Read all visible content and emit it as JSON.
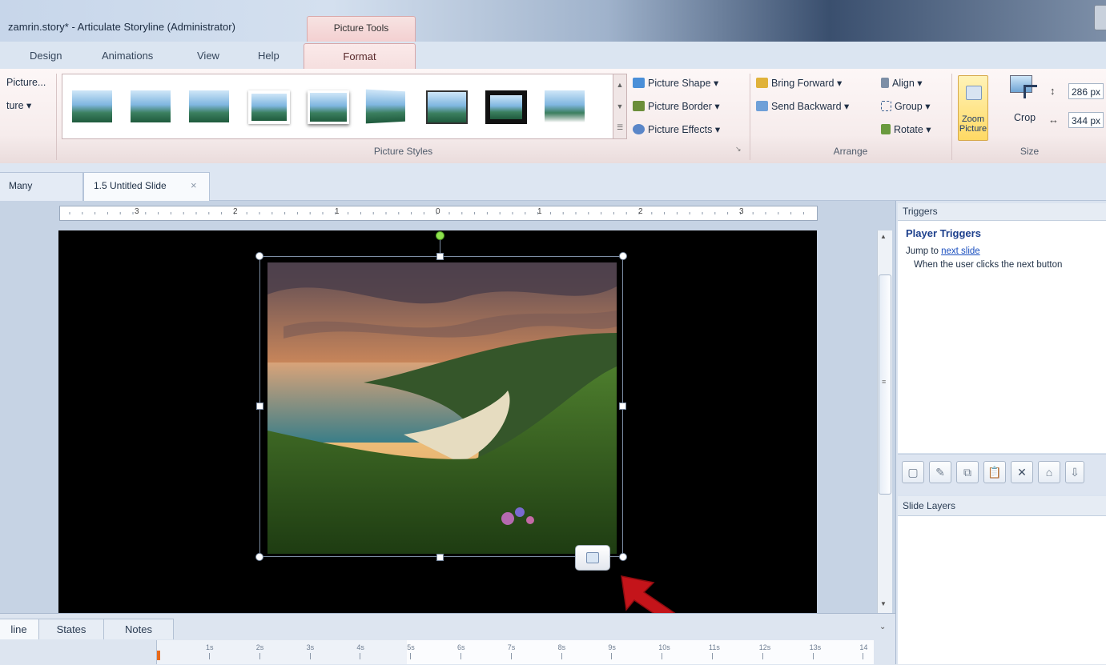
{
  "window": {
    "title": "zamrin.story* - Articulate Storyline (Administrator)",
    "context_tab": "Picture Tools"
  },
  "ribbon_tabs": [
    "Design",
    "Animations",
    "View",
    "Help"
  ],
  "active_tab": "Format",
  "ribbon": {
    "left_partial": {
      "item1": "Picture...",
      "item2": "ture ▾"
    },
    "picture_styles": {
      "group_label": "Picture Styles",
      "picture_shape": "Picture Shape ▾",
      "picture_border": "Picture Border ▾",
      "picture_effects": "Picture Effects ▾"
    },
    "arrange": {
      "group_label": "Arrange",
      "bring_forward": "Bring Forward ▾",
      "send_backward": "Send Backward ▾",
      "align": "Align ▾",
      "group": "Group ▾",
      "rotate": "Rotate ▾"
    },
    "size": {
      "group_label": "Size",
      "zoom_picture": "Zoom Picture",
      "crop": "Crop",
      "height_value": "286 px",
      "width_value": "344 px"
    }
  },
  "slide_tabs": [
    {
      "label": "Many"
    },
    {
      "label": "1.5 Untitled Slide",
      "close": "×"
    }
  ],
  "ruler_labels": [
    "3",
    "2",
    "1",
    "0",
    "1",
    "2",
    "3"
  ],
  "timeline": {
    "tabs": [
      "line",
      "States",
      "Notes"
    ],
    "ticks": [
      "1s",
      "2s",
      "3s",
      "4s",
      "5s",
      "6s",
      "7s",
      "8s",
      "9s",
      "10s",
      "11s",
      "12s",
      "13s",
      "14"
    ]
  },
  "triggers_panel": {
    "header": "Triggers",
    "section_title": "Player Triggers",
    "trigger_prefix": "Jump to ",
    "trigger_link": "next slide",
    "trigger_condition": "When the user clicks the next button"
  },
  "layers_panel": {
    "header": "Slide Layers"
  },
  "colors": {
    "accent_format_tab": "#f3cfd0",
    "link": "#1a4fbf",
    "arrow": "#c4141a",
    "rotate_handle": "#8ee04d"
  },
  "icons": [
    "picture-shape-icon",
    "picture-border-icon",
    "picture-effects-icon",
    "bring-forward-icon",
    "send-backward-icon",
    "align-icon",
    "group-icon",
    "rotate-icon",
    "zoom-picture-icon",
    "crop-icon",
    "height-icon",
    "width-icon",
    "magnifier-icon",
    "close-icon",
    "new-trigger-icon",
    "edit-trigger-icon",
    "copy-trigger-icon",
    "paste-trigger-icon",
    "delete-trigger-icon",
    "lock-icon"
  ]
}
